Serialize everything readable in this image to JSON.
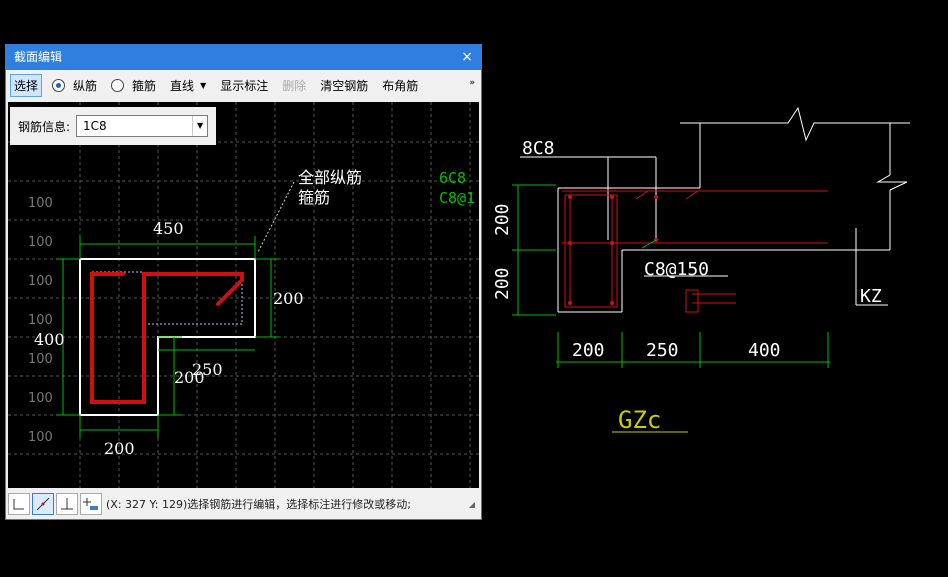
{
  "dialog": {
    "title": "截面编辑",
    "close": "×",
    "toolbar": {
      "select": "选择",
      "longitudinal": "纵筋",
      "stirrup": "箍筋",
      "line": "直线",
      "show_dim": "显示标注",
      "delete": "删除",
      "clear": "清空钢筋",
      "corner": "布角筋",
      "more": "»"
    },
    "info_label": "钢筋信息:",
    "info_value": "1C8",
    "grid_label": "100",
    "drawing": {
      "top_width": "450",
      "right_height": "200",
      "left_height": "400",
      "inner_height": "200",
      "inner_width": "250",
      "bottom_width": "200",
      "note1": "全部纵筋",
      "note2": "箍筋",
      "note3": "6C8",
      "note4": "C8@1"
    },
    "status_text": "(X: 327 Y: 129)选择钢筋进行编辑，选择标注进行修改或移动;"
  },
  "cad": {
    "label_top": "8C8",
    "dim_vert_1": "200",
    "dim_vert_2": "200",
    "stirrup": "C8@150",
    "column": "KZ",
    "dim_h_1": "200",
    "dim_h_2": "250",
    "dim_h_3": "400",
    "title": "GZc"
  },
  "colors": {
    "title_bar": "#2f7fde",
    "rebar": "#d01010",
    "dim": "#00c000"
  }
}
